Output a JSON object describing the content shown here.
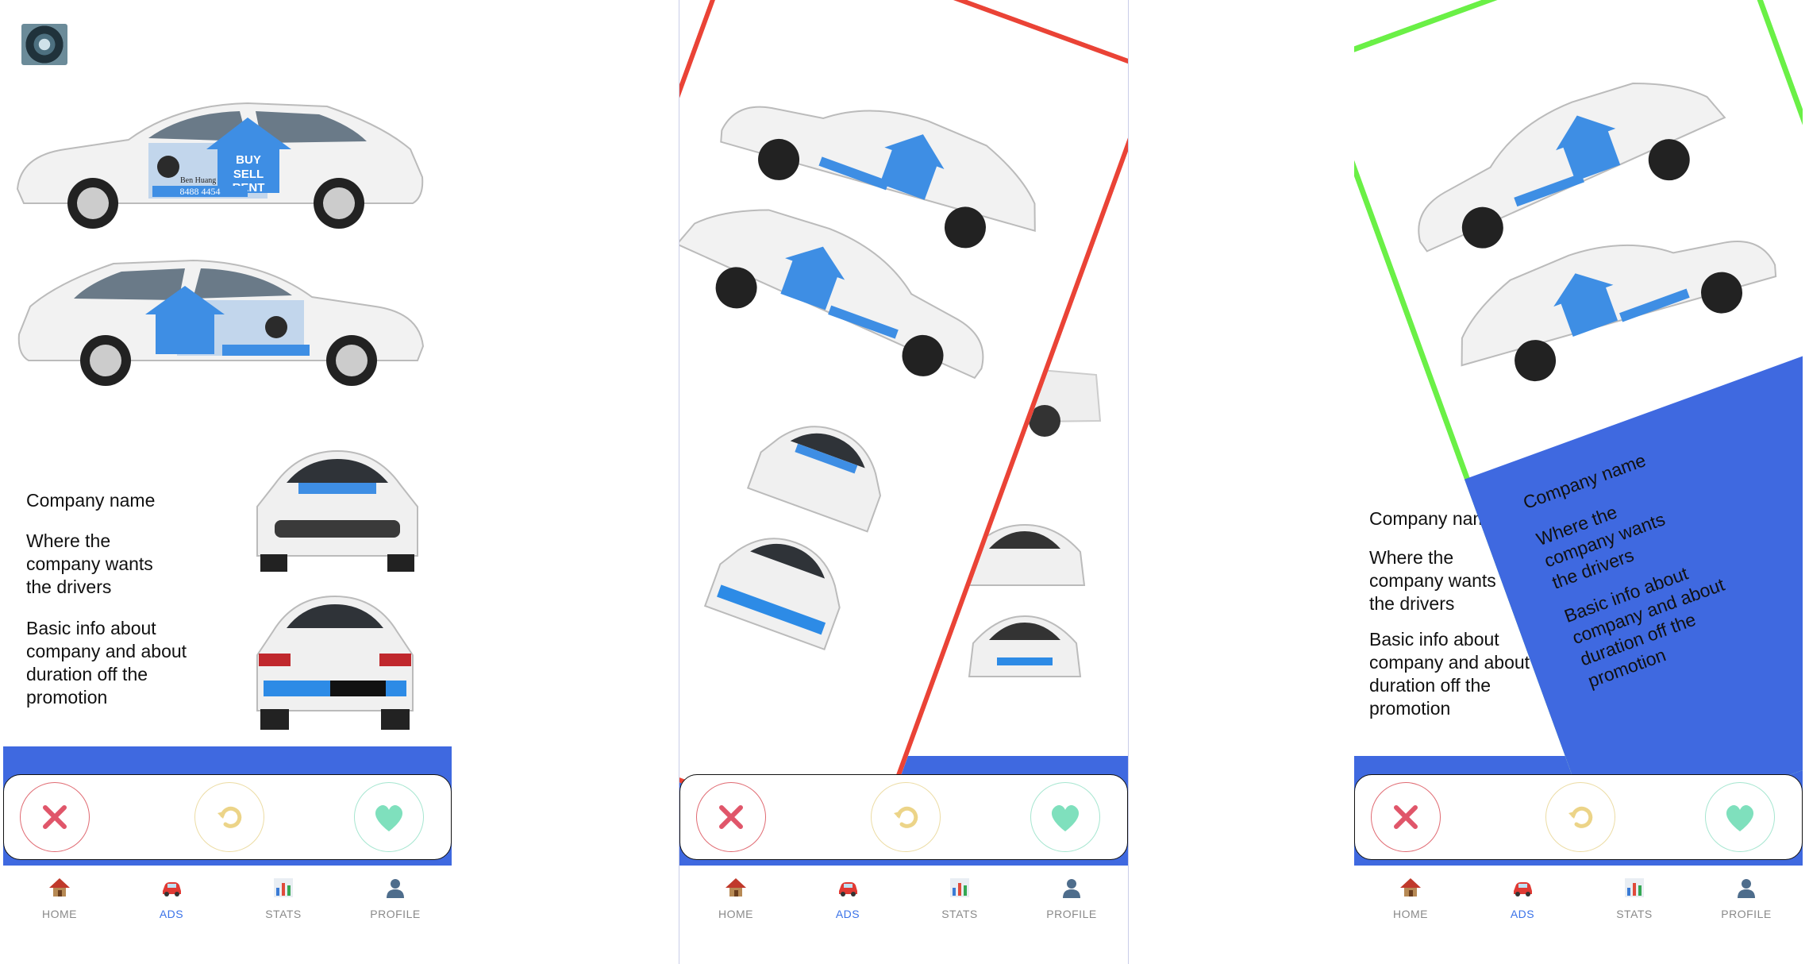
{
  "car_decal": {
    "line1": "BUY",
    "line2": "SELL",
    "line3": "RENT",
    "agent_name": "Ben Huang",
    "phone": "8488 4454"
  },
  "card": {
    "company_name": "Company name",
    "location_line1": "Where the",
    "location_line2": "company wants",
    "location_line3": "the drivers",
    "info_line1": "Basic info about",
    "info_line2": "company and about",
    "info_line3": "duration off  the",
    "info_line4": "promotion"
  },
  "tabs": [
    {
      "label": "HOME",
      "icon": "house-icon",
      "active": false
    },
    {
      "label": "ADS",
      "icon": "car-icon",
      "active": true
    },
    {
      "label": "STATS",
      "icon": "bar-chart-icon",
      "active": false
    },
    {
      "label": "PROFILE",
      "icon": "person-icon",
      "active": false
    }
  ],
  "colors": {
    "accent_blue": "#3f69e0",
    "reject_red": "#e0566a",
    "undo_yellow": "#ecd488",
    "like_green": "#7fe0bd",
    "swipe_left_frame": "#ea4336",
    "swipe_right_frame": "#6af046",
    "active_tab": "#3a72e8"
  }
}
